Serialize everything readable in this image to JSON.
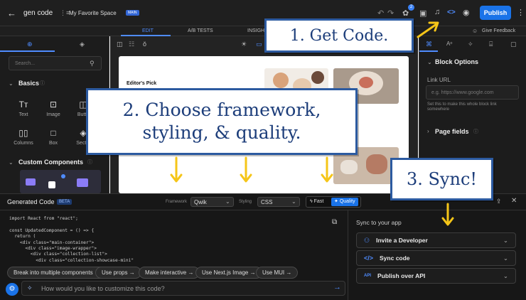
{
  "header": {
    "title": "gen code",
    "space": "My Favorite Space",
    "space_badge": "MAIN",
    "publish_label": "Publish",
    "notification_count": "2"
  },
  "tabs": {
    "edit": "EDIT",
    "ab_tests": "A/B TESTS",
    "insights": "INSIGH",
    "feedback": "Give Feedback"
  },
  "left": {
    "search_placeholder": "Search...",
    "basics": "Basics",
    "tiles": [
      "Text",
      "Image",
      "Butto",
      "Columns",
      "Box",
      "Sectio"
    ],
    "custom": "Custom Components"
  },
  "canvas": {
    "editors_pick": "Editor's Pick"
  },
  "right": {
    "block_options": "Block Options",
    "link_url": "Link URL",
    "link_placeholder": "e.g. https://www.google.com",
    "link_hint": "Set this to make this whole block link somewhere",
    "page_fields": "Page fields"
  },
  "generated": {
    "title": "Generated Code",
    "badge": "BETA",
    "framework_label": "Framework",
    "framework_value": "Qwik",
    "styling_label": "Styling",
    "styling_value": "CSS",
    "fast": "Fast",
    "quality": "Quality",
    "code_lines": [
      "import React from \"react\";",
      "",
      "const UpdatedComponent = () => {",
      "  return (",
      "    <div class=\"main-container\">",
      "      <div class=\"image-wrapper\">",
      "        <div class=\"collection-list\">",
      "          <div class=\"collection-showcase-mini\""
    ],
    "chips": [
      "Break into multiple components",
      "Use props",
      "Make interactive",
      "Use Next.js Image",
      "Use MUI"
    ],
    "prompt_placeholder": "How would you like to customize this code?"
  },
  "sync": {
    "title": "Sync to your app",
    "items": [
      "Invite a Developer",
      "Sync code",
      "Publish over API"
    ],
    "api_badge": "API"
  },
  "callouts": {
    "step1": "1. Get Code.",
    "step2_line1": "2. Choose framework,",
    "step2_line2": "styling, & quality.",
    "step3": "3. Sync!"
  },
  "colors": {
    "accent": "#1a73e8",
    "callout_border": "#2c5aa0",
    "arrow": "#f5c518"
  }
}
